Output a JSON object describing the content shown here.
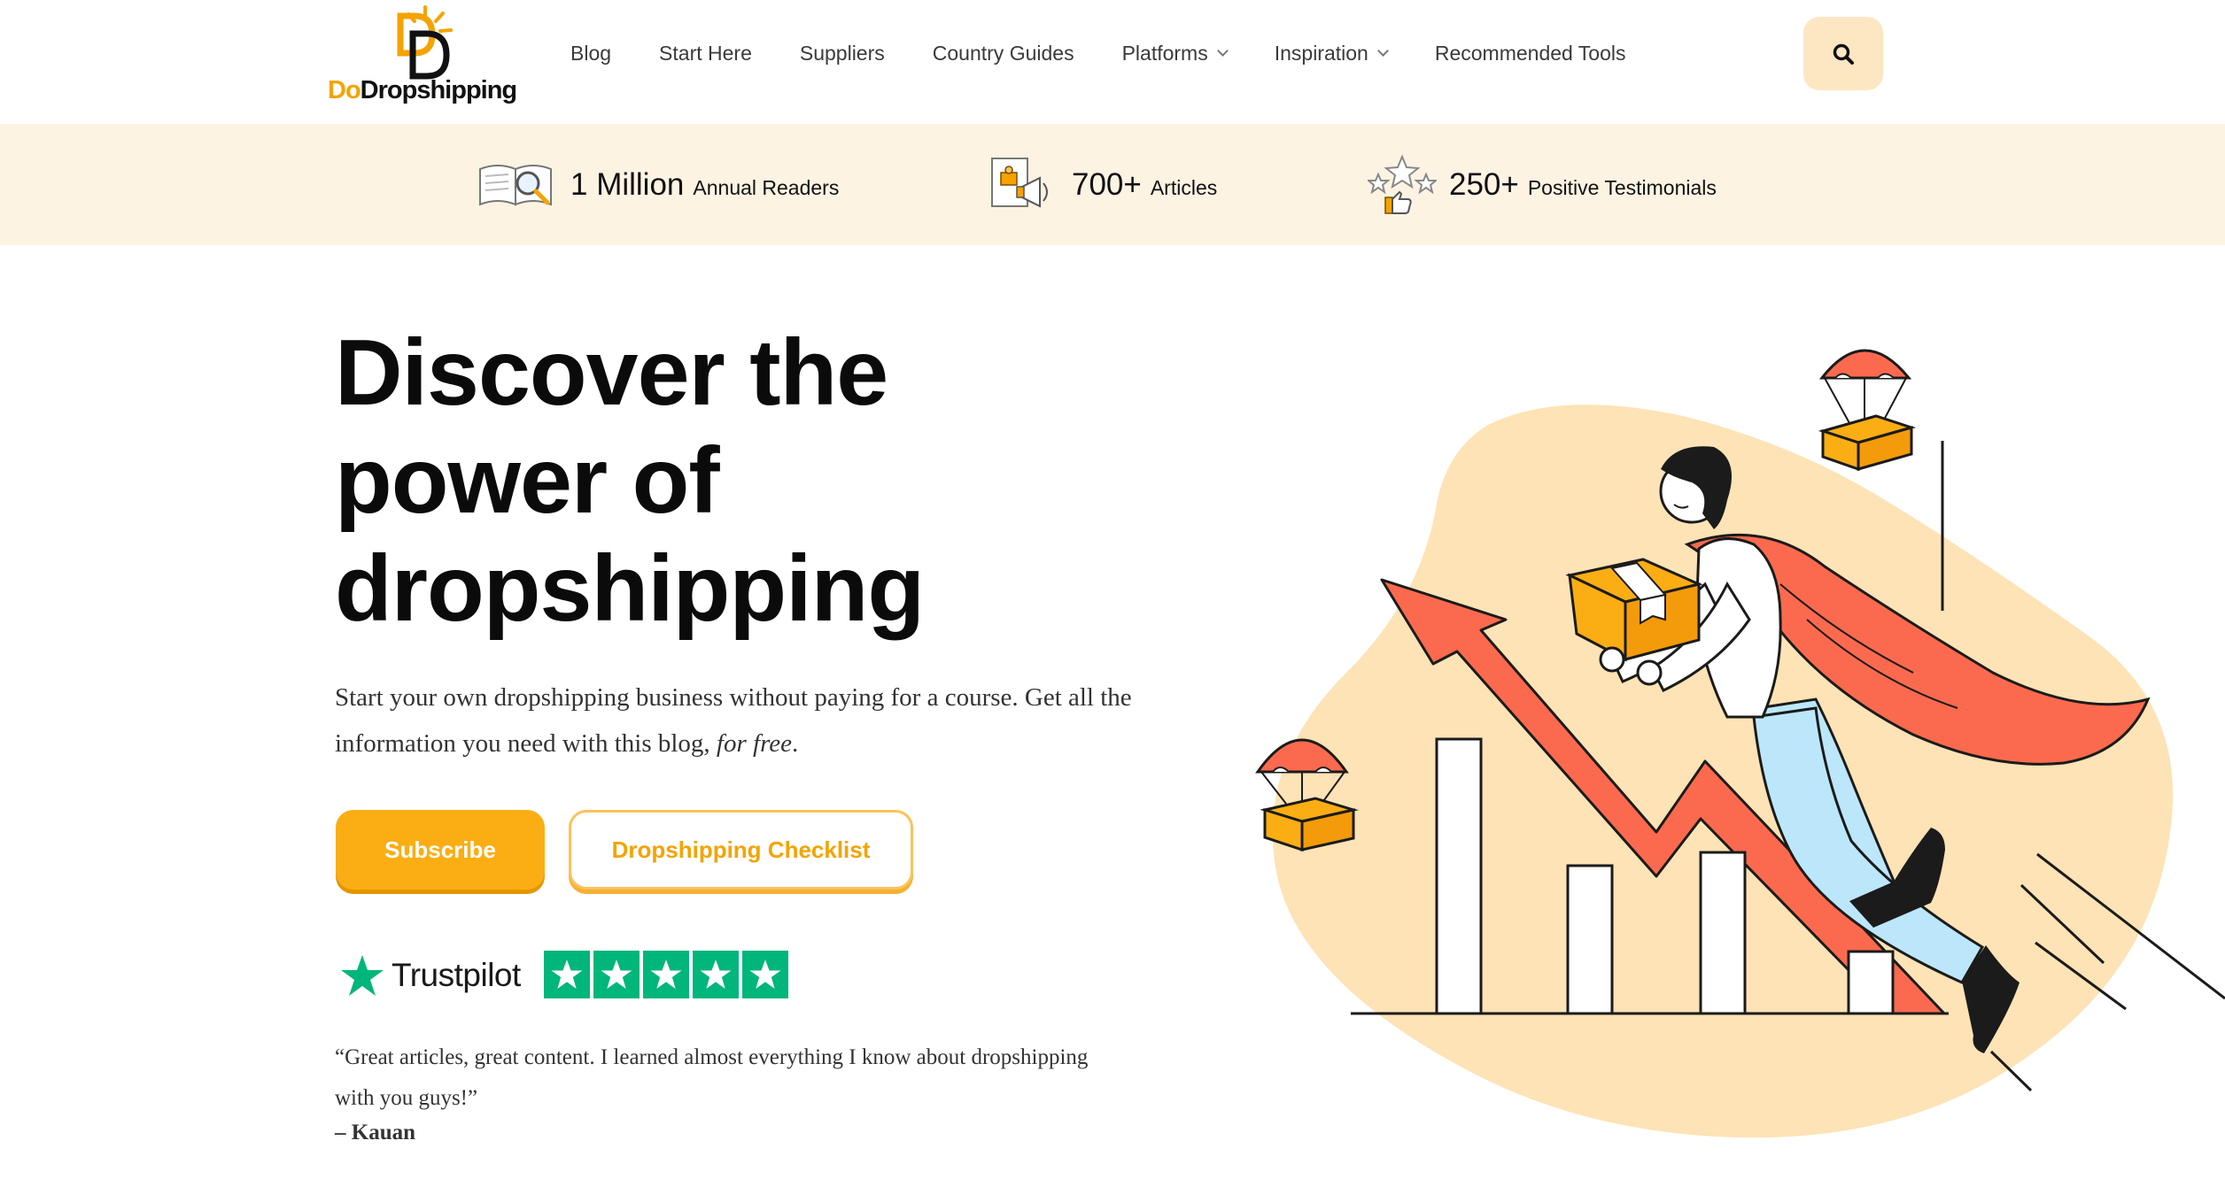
{
  "brand": {
    "logo_prefix": "Do",
    "logo_suffix": "Dropshipping"
  },
  "nav": {
    "items": [
      {
        "label": "Blog",
        "has_dropdown": false
      },
      {
        "label": "Start Here",
        "has_dropdown": false
      },
      {
        "label": "Suppliers",
        "has_dropdown": false
      },
      {
        "label": "Country Guides",
        "has_dropdown": false
      },
      {
        "label": "Platforms",
        "has_dropdown": true
      },
      {
        "label": "Inspiration",
        "has_dropdown": true
      },
      {
        "label": "Recommended Tools",
        "has_dropdown": false
      }
    ],
    "search_icon": "search-icon"
  },
  "stats": [
    {
      "value": "1 Million",
      "label": "Annual Readers",
      "icon": "book-magnifier-icon"
    },
    {
      "value": "700+",
      "label": "Articles",
      "icon": "article-megaphone-icon"
    },
    {
      "value": "250+",
      "label": "Positive Testimonials",
      "icon": "stars-thumbs-up-icon"
    }
  ],
  "hero": {
    "title_lines": [
      "Discover the",
      "power of",
      "dropshipping"
    ],
    "subtitle_main": "Start your own dropshipping business without paying for a course. Get all the information you need with this blog, ",
    "subtitle_emphasis": "for free",
    "subtitle_end": ".",
    "primary_button": "Subscribe",
    "secondary_button": "Dropshipping Checklist"
  },
  "trustpilot": {
    "brand": "Trustpilot",
    "stars": 5
  },
  "testimonial": {
    "quote": "“Great articles, great content. I learned almost everything I know about dropshipping with you guys!”",
    "author": "– Kauan"
  },
  "colors": {
    "accent": "#fbad14",
    "band": "#fdf3e3",
    "search_bg": "#fde6c2",
    "trustpilot_green": "#00b67a",
    "cape": "#fb6a4e",
    "blob": "#fde3b5"
  }
}
